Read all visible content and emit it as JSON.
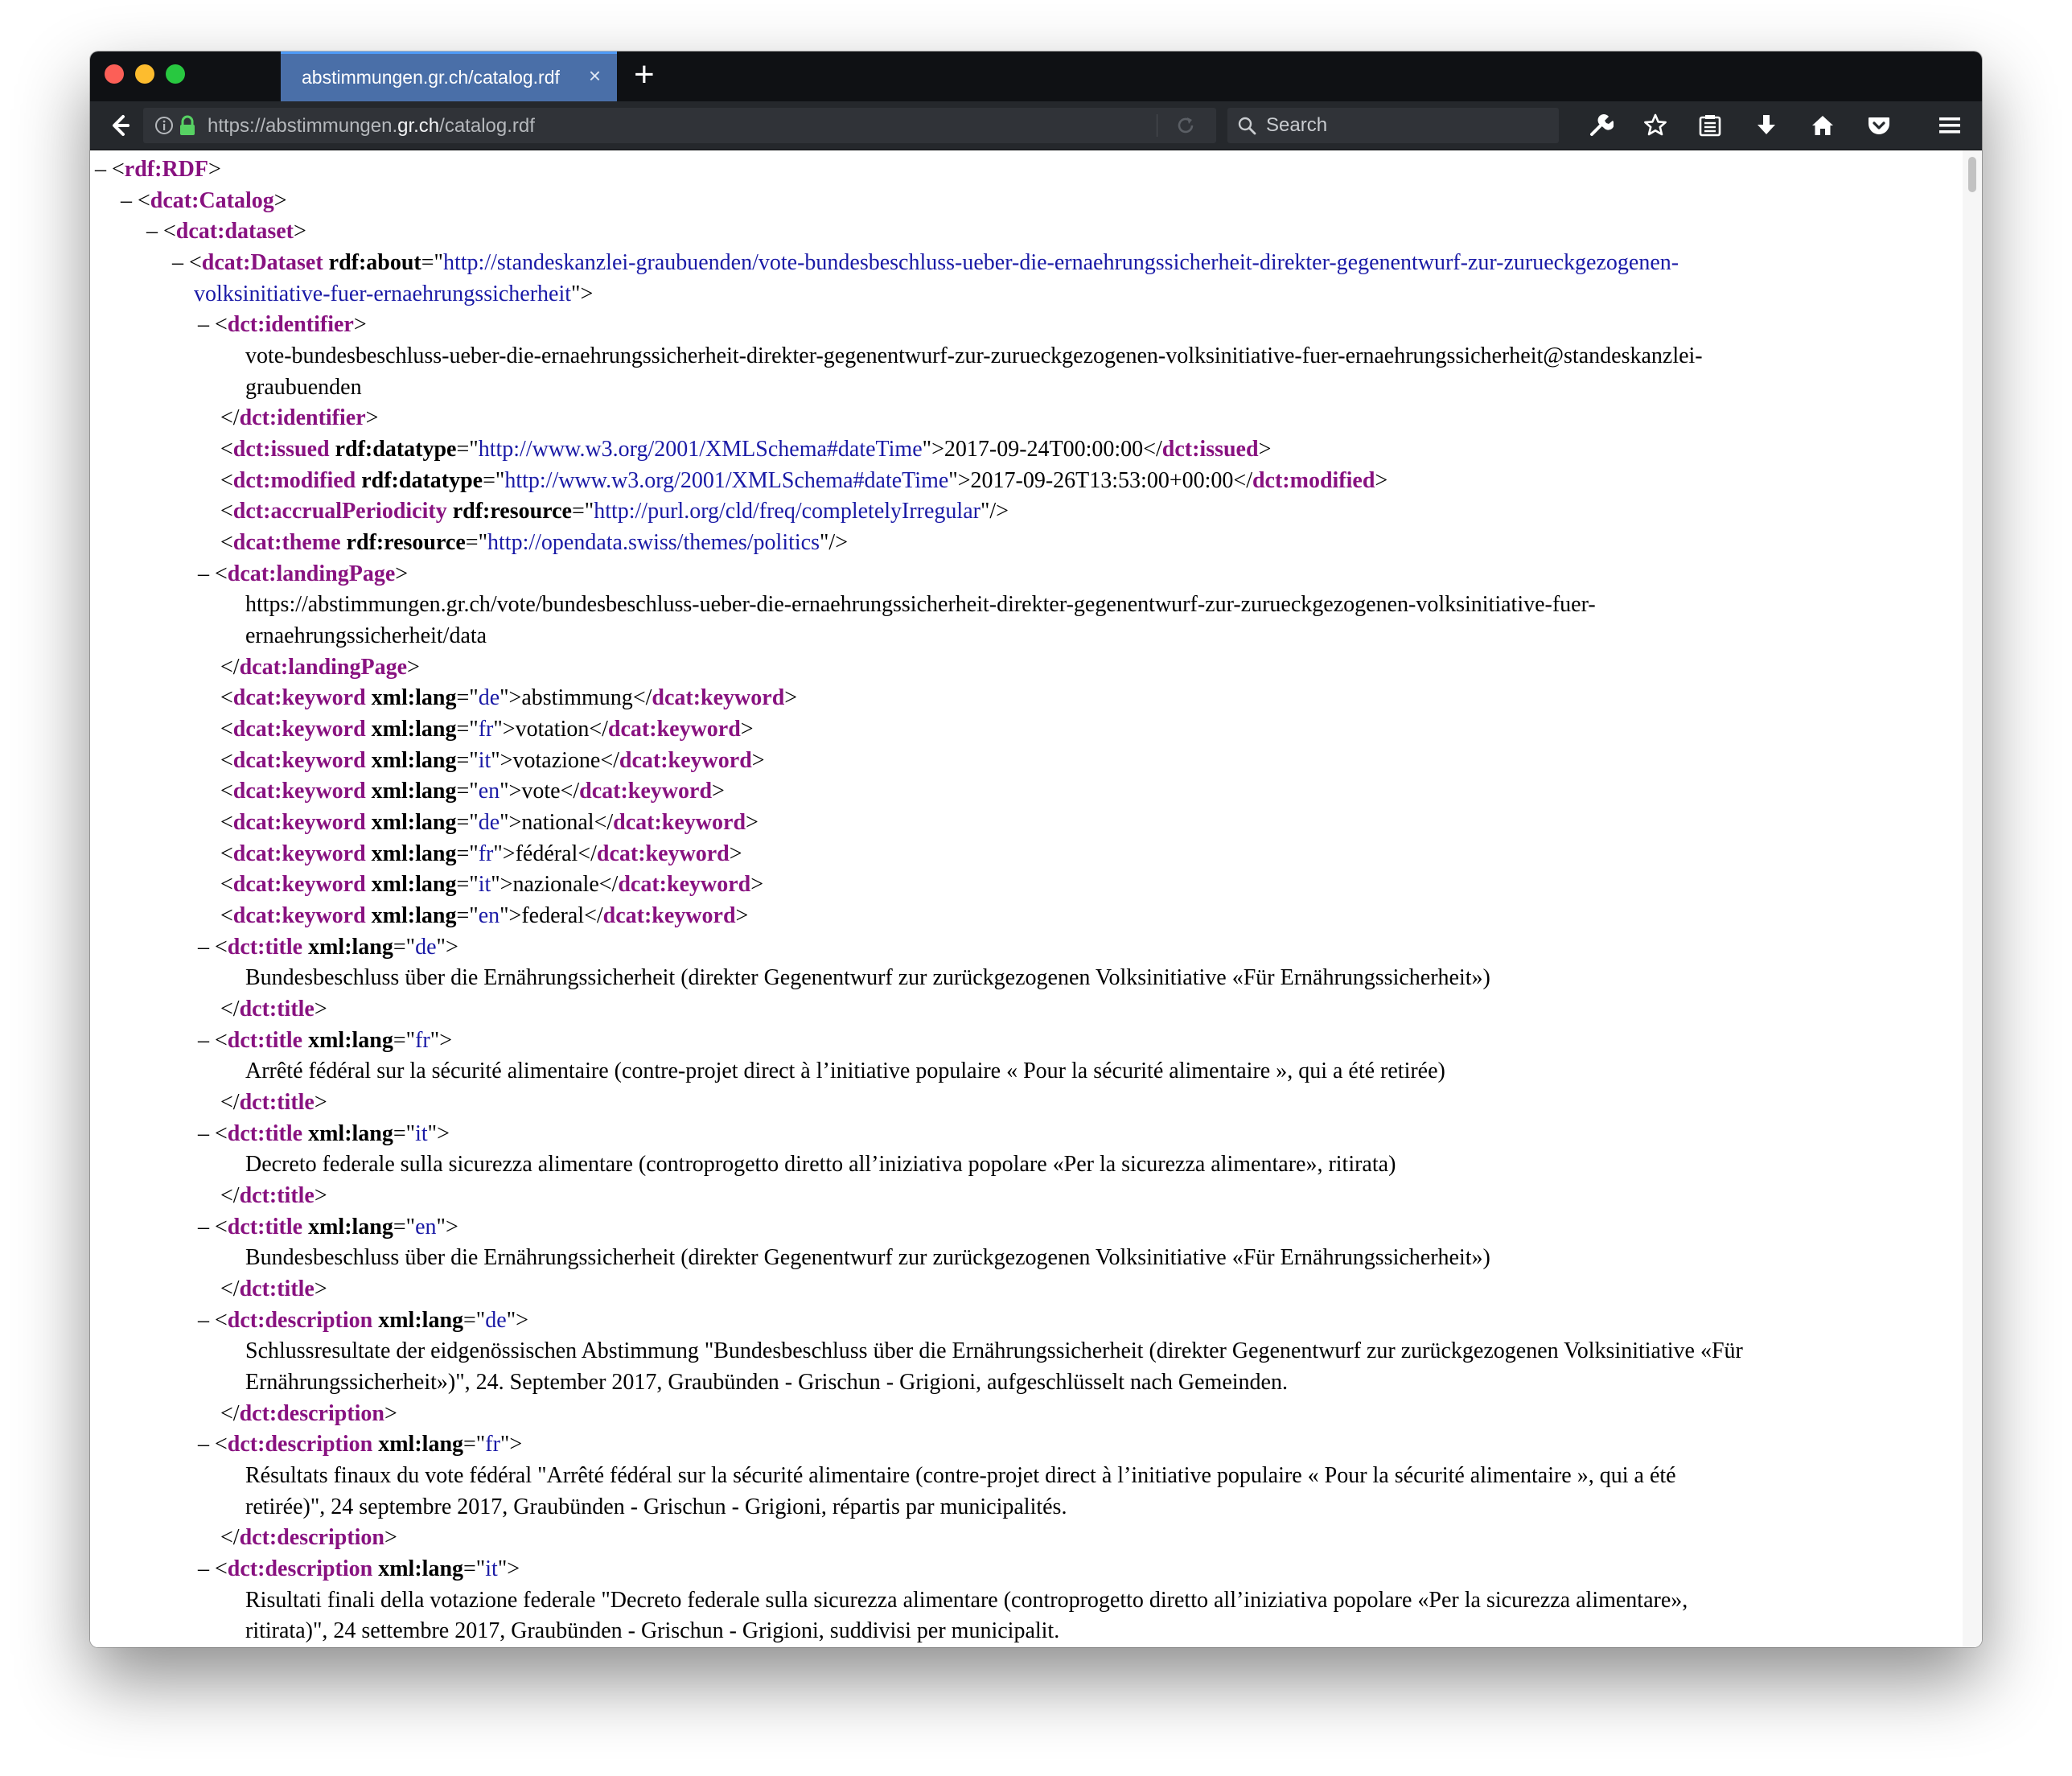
{
  "browser": {
    "tab": {
      "title": "abstimmungen.gr.ch/catalog.rdf",
      "close_glyph": "×"
    },
    "new_tab_glyph": "+",
    "url": {
      "prefix": "https://abstimmungen.",
      "host": "gr.ch",
      "path": "/catalog.rdf"
    },
    "search": {
      "placeholder": "Search"
    },
    "icons": [
      "back-icon",
      "info-icon",
      "lock-icon",
      "reload-icon",
      "search-icon",
      "wrench-icon",
      "bookmark-star-icon",
      "reader-list-icon",
      "download-icon",
      "home-icon",
      "pocket-icon",
      "menu-icon"
    ],
    "colors": {
      "tab_active": "#4a6fa8",
      "toolbar": "#25282c",
      "tabstrip": "#0f1114",
      "lock": "#57d163"
    }
  },
  "xml": {
    "fold_glyph": "–",
    "rdf_root": "rdf:RDF",
    "catalog": "dcat:Catalog",
    "dataset_list": "dcat:dataset",
    "dataset": {
      "tag": "dcat:Dataset",
      "attr": "rdf:about",
      "about_line1": "http://standeskanzlei-graubuenden/vote-bundesbeschluss-ueber-die-ernaehrungssicherheit-direkter-gegenentwurf-zur-zurueckgezogenen-",
      "about_line2": "volksinitiative-fuer-ernaehrungssicherheit"
    },
    "identifier": {
      "tag": "dct:identifier",
      "line1": "vote-bundesbeschluss-ueber-die-ernaehrungssicherheit-direkter-gegenentwurf-zur-zurueckgezogenen-volksinitiative-fuer-ernaehrungssicherheit@standeskanzlei-",
      "line2": "graubuenden"
    },
    "issued": {
      "tag": "dct:issued",
      "attr": "rdf:datatype",
      "attr_value": "http://www.w3.org/2001/XMLSchema#dateTime",
      "text": "2017-09-24T00:00:00"
    },
    "modified": {
      "tag": "dct:modified",
      "attr": "rdf:datatype",
      "attr_value": "http://www.w3.org/2001/XMLSchema#dateTime",
      "text": "2017-09-26T13:53:00+00:00"
    },
    "accrual": {
      "tag": "dct:accrualPeriodicity",
      "attr": "rdf:resource",
      "attr_value": "http://purl.org/cld/freq/completelyIrregular"
    },
    "theme": {
      "tag": "dcat:theme",
      "attr": "rdf:resource",
      "attr_value": "http://opendata.swiss/themes/politics"
    },
    "landing": {
      "tag": "dcat:landingPage",
      "line1": "https://abstimmungen.gr.ch/vote/bundesbeschluss-ueber-die-ernaehrungssicherheit-direkter-gegenentwurf-zur-zurueckgezogenen-volksinitiative-fuer-",
      "line2": "ernaehrungssicherheit/data"
    },
    "keyword_tag": "dcat:keyword",
    "lang_attr": "xml:lang",
    "keywords": [
      {
        "lang": "de",
        "text": "abstimmung"
      },
      {
        "lang": "fr",
        "text": "votation"
      },
      {
        "lang": "it",
        "text": "votazione"
      },
      {
        "lang": "en",
        "text": "vote"
      },
      {
        "lang": "de",
        "text": "national"
      },
      {
        "lang": "fr",
        "text": "fédéral"
      },
      {
        "lang": "it",
        "text": "nazionale"
      },
      {
        "lang": "en",
        "text": "federal"
      }
    ],
    "title_tag": "dct:title",
    "titles": [
      {
        "lang": "de",
        "text": "Bundesbeschluss über die Ernährungssicherheit (direkter Gegenentwurf zur zurückgezogenen Volksinitiative «Für Ernährungssicherheit»)"
      },
      {
        "lang": "fr",
        "text": "Arrêté fédéral sur la sécurité alimentaire (contre-projet direct à l’initiative populaire « Pour la sécurité alimentaire », qui a été retirée)"
      },
      {
        "lang": "it",
        "text": "Decreto federale sulla sicurezza alimentare (controprogetto diretto all’iniziativa popolare «Per la sicurezza alimentare», ritirata)"
      },
      {
        "lang": "en",
        "text": "Bundesbeschluss über die Ernährungssicherheit (direkter Gegenentwurf zur zurückgezogenen Volksinitiative «Für Ernährungssicherheit»)"
      }
    ],
    "description_tag": "dct:description",
    "descriptions": [
      {
        "lang": "de",
        "line1": "Schlussresultate der eidgenössischen Abstimmung \"Bundesbeschluss über die Ernährungssicherheit (direkter Gegenentwurf zur zurückgezogenen Volksinitiative «Für",
        "line2": "Ernährungssicherheit»)\", 24. September 2017, Graubünden - Grischun - Grigioni, aufgeschlüsselt nach Gemeinden."
      },
      {
        "lang": "fr",
        "line1": "Résultats finaux du vote fédéral \"Arrêté fédéral sur la sécurité alimentaire (contre-projet direct à l’initiative populaire « Pour la sécurité alimentaire », qui a été",
        "line2": "retirée)\", 24 septembre 2017, Graubünden - Grischun - Grigioni, répartis par municipalités."
      },
      {
        "lang": "it",
        "line1": "Risultati finali della votazione federale \"Decreto federale sulla sicurezza alimentare (controprogetto diretto all’iniziativa popolare «Per la sicurezza alimentare»,",
        "line2": "ritirata)\", 24 settembre 2017, Graubünden - Grischun - Grigioni, suddivisi per municipalit."
      }
    ]
  }
}
